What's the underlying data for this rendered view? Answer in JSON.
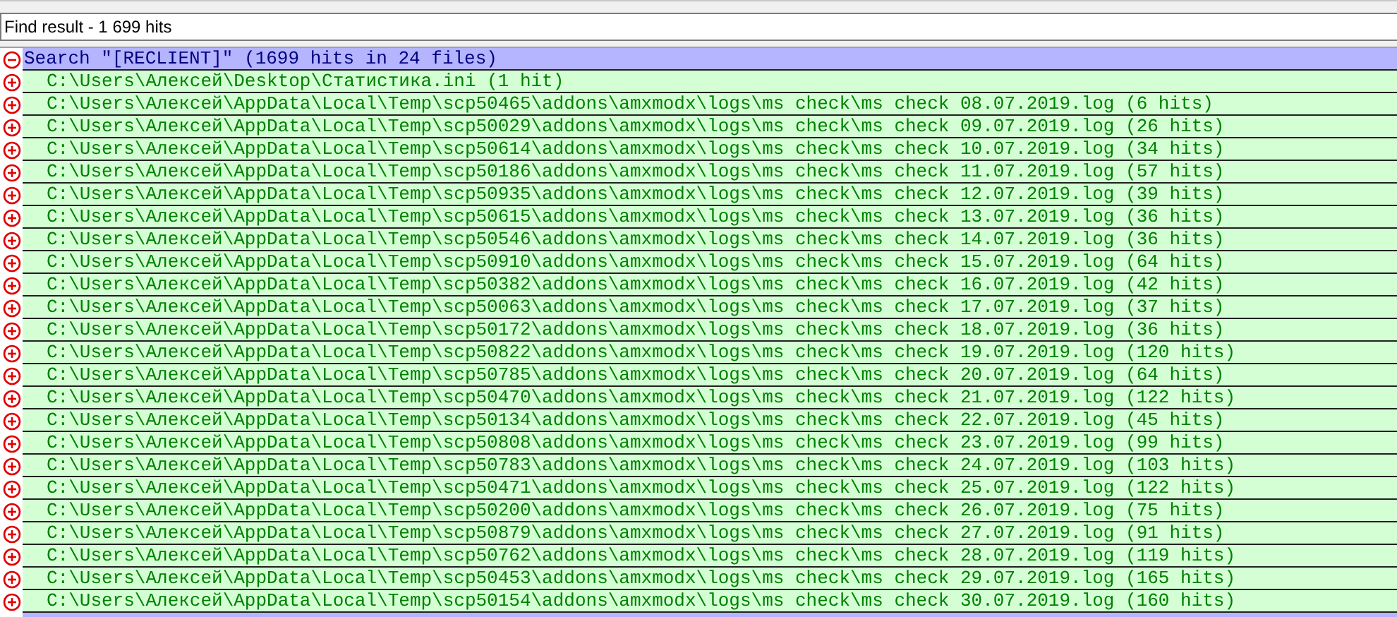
{
  "panel": {
    "title": "Find result - 1 699 hits"
  },
  "search": {
    "label": "Search \"[RECLIENT]\" (1699 hits in 24 files)",
    "expanded": true,
    "files": [
      {
        "label": "C:\\Users\\Алексей\\Desktop\\Статистика.ini (1 hit)",
        "expanded": false
      },
      {
        "label": "C:\\Users\\Алексей\\AppData\\Local\\Temp\\scp50465\\addons\\amxmodx\\logs\\ms check\\ms check 08.07.2019.log (6 hits)",
        "expanded": false
      },
      {
        "label": "C:\\Users\\Алексей\\AppData\\Local\\Temp\\scp50029\\addons\\amxmodx\\logs\\ms check\\ms check 09.07.2019.log (26 hits)",
        "expanded": false
      },
      {
        "label": "C:\\Users\\Алексей\\AppData\\Local\\Temp\\scp50614\\addons\\amxmodx\\logs\\ms check\\ms check 10.07.2019.log (34 hits)",
        "expanded": false
      },
      {
        "label": "C:\\Users\\Алексей\\AppData\\Local\\Temp\\scp50186\\addons\\amxmodx\\logs\\ms check\\ms check 11.07.2019.log (57 hits)",
        "expanded": false
      },
      {
        "label": "C:\\Users\\Алексей\\AppData\\Local\\Temp\\scp50935\\addons\\amxmodx\\logs\\ms check\\ms check 12.07.2019.log (39 hits)",
        "expanded": false
      },
      {
        "label": "C:\\Users\\Алексей\\AppData\\Local\\Temp\\scp50615\\addons\\amxmodx\\logs\\ms check\\ms check 13.07.2019.log (36 hits)",
        "expanded": false
      },
      {
        "label": "C:\\Users\\Алексей\\AppData\\Local\\Temp\\scp50546\\addons\\amxmodx\\logs\\ms check\\ms check 14.07.2019.log (36 hits)",
        "expanded": false
      },
      {
        "label": "C:\\Users\\Алексей\\AppData\\Local\\Temp\\scp50910\\addons\\amxmodx\\logs\\ms check\\ms check 15.07.2019.log (64 hits)",
        "expanded": false
      },
      {
        "label": "C:\\Users\\Алексей\\AppData\\Local\\Temp\\scp50382\\addons\\amxmodx\\logs\\ms check\\ms check 16.07.2019.log (42 hits)",
        "expanded": false
      },
      {
        "label": "C:\\Users\\Алексей\\AppData\\Local\\Temp\\scp50063\\addons\\amxmodx\\logs\\ms check\\ms check 17.07.2019.log (37 hits)",
        "expanded": false
      },
      {
        "label": "C:\\Users\\Алексей\\AppData\\Local\\Temp\\scp50172\\addons\\amxmodx\\logs\\ms check\\ms check 18.07.2019.log (36 hits)",
        "expanded": false
      },
      {
        "label": "C:\\Users\\Алексей\\AppData\\Local\\Temp\\scp50822\\addons\\amxmodx\\logs\\ms check\\ms check 19.07.2019.log (120 hits)",
        "expanded": false
      },
      {
        "label": "C:\\Users\\Алексей\\AppData\\Local\\Temp\\scp50785\\addons\\amxmodx\\logs\\ms check\\ms check 20.07.2019.log (64 hits)",
        "expanded": false
      },
      {
        "label": "C:\\Users\\Алексей\\AppData\\Local\\Temp\\scp50470\\addons\\amxmodx\\logs\\ms check\\ms check 21.07.2019.log (122 hits)",
        "expanded": false
      },
      {
        "label": "C:\\Users\\Алексей\\AppData\\Local\\Temp\\scp50134\\addons\\amxmodx\\logs\\ms check\\ms check 22.07.2019.log (45 hits)",
        "expanded": false
      },
      {
        "label": "C:\\Users\\Алексей\\AppData\\Local\\Temp\\scp50808\\addons\\amxmodx\\logs\\ms check\\ms check 23.07.2019.log (99 hits)",
        "expanded": false
      },
      {
        "label": "C:\\Users\\Алексей\\AppData\\Local\\Temp\\scp50783\\addons\\amxmodx\\logs\\ms check\\ms check 24.07.2019.log (103 hits)",
        "expanded": false
      },
      {
        "label": "C:\\Users\\Алексей\\AppData\\Local\\Temp\\scp50471\\addons\\amxmodx\\logs\\ms check\\ms check 25.07.2019.log (122 hits)",
        "expanded": false
      },
      {
        "label": "C:\\Users\\Алексей\\AppData\\Local\\Temp\\scp50200\\addons\\amxmodx\\logs\\ms check\\ms check 26.07.2019.log (75 hits)",
        "expanded": false
      },
      {
        "label": "C:\\Users\\Алексей\\AppData\\Local\\Temp\\scp50879\\addons\\amxmodx\\logs\\ms check\\ms check 27.07.2019.log (91 hits)",
        "expanded": false
      },
      {
        "label": "C:\\Users\\Алексей\\AppData\\Local\\Temp\\scp50762\\addons\\amxmodx\\logs\\ms check\\ms check 28.07.2019.log (119 hits)",
        "expanded": false
      },
      {
        "label": "C:\\Users\\Алексей\\AppData\\Local\\Temp\\scp50453\\addons\\amxmodx\\logs\\ms check\\ms check 29.07.2019.log (165 hits)",
        "expanded": false
      },
      {
        "label": "C:\\Users\\Алексей\\AppData\\Local\\Temp\\scp50154\\addons\\amxmodx\\logs\\ms check\\ms check 30.07.2019.log (160 hits)",
        "expanded": false
      }
    ]
  }
}
